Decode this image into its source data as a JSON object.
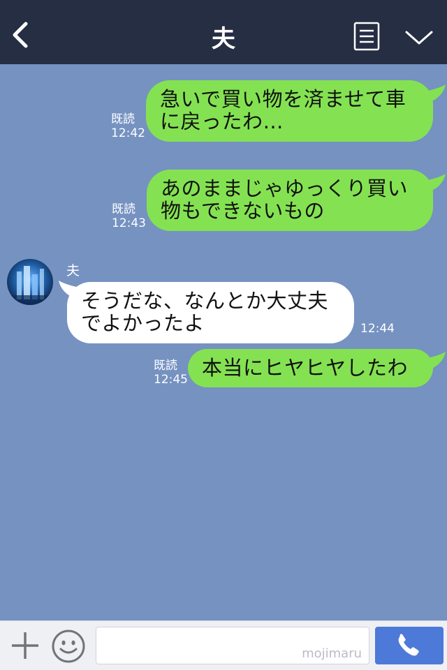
{
  "header": {
    "title": "夫",
    "back_icon": "chevron-left-icon",
    "notes_icon": "notes-icon",
    "menu_icon": "chevron-down-icon"
  },
  "colors": {
    "header_bg": "#252e43",
    "chat_bg": "#7592c1",
    "my_bubble": "#84e252",
    "their_bubble": "#ffffff",
    "call_button": "#4d79d8"
  },
  "messages": [
    {
      "sender": "me",
      "lines": [
        "急いで買い物を済ませて車",
        "に戻ったわ…"
      ],
      "read": "既読",
      "time": "12:42"
    },
    {
      "sender": "me",
      "lines": [
        "あのままじゃゆっくり買い",
        "物もできないもの"
      ],
      "read": "既読",
      "time": "12:43"
    },
    {
      "sender": "夫",
      "lines": [
        "そうだな、なんとか大丈夫",
        "でよかったよ"
      ],
      "time": "12:44"
    },
    {
      "sender": "me",
      "lines": [
        "本当にヒヤヒヤしたわ"
      ],
      "read": "既読",
      "time": "12:45"
    }
  ],
  "footer": {
    "plus_icon": "plus-icon",
    "emoji_icon": "smiley-icon",
    "input_value": "",
    "watermark": "mojimaru",
    "call_icon": "phone-icon"
  }
}
